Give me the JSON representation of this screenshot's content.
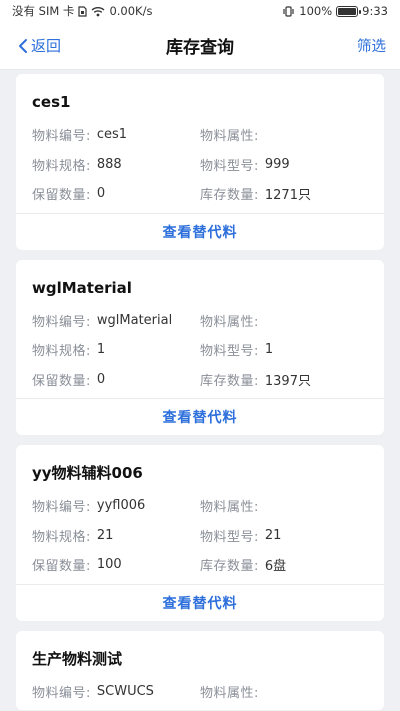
{
  "status_bar": {
    "carrier": "没有 SIM 卡",
    "speed": "0.00K/s",
    "battery_text": "100%",
    "battery_level": 1.0,
    "time": "9:33"
  },
  "nav": {
    "back_label": "返回",
    "title": "库存查询",
    "filter_label": "筛选"
  },
  "labels": {
    "code": "物料编号:",
    "attr": "物料属性:",
    "spec": "物料规格:",
    "model": "物料型号:",
    "reserved": "保留数量:",
    "stock": "库存数量:",
    "action": "查看替代料"
  },
  "items": [
    {
      "name": "ces1",
      "code": "ces1",
      "attr": "",
      "spec": "888",
      "model": "999",
      "reserved": "0",
      "stock": "1271只"
    },
    {
      "name": "wglMaterial",
      "code": "wglMaterial",
      "attr": "",
      "spec": "1",
      "model": "1",
      "reserved": "0",
      "stock": "1397只"
    },
    {
      "name": "yy物料辅料006",
      "code": "yyfl006",
      "attr": "",
      "spec": "21",
      "model": "21",
      "reserved": "100",
      "stock": "6盘"
    },
    {
      "name": "生产物料测试",
      "code": "SCWUCS",
      "attr": ""
    }
  ]
}
